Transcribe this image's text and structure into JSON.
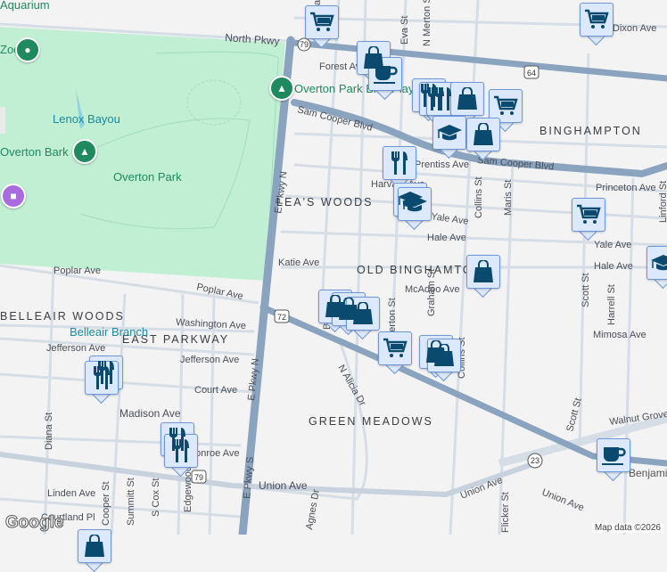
{
  "map": {
    "streets": [
      "North Pkwy",
      "Forest Ave",
      "Sam Cooper Blvd",
      "Sam Cooper Blvd",
      "E Pkwy N",
      "E Pkwy N",
      "E Pkwy S",
      "Katie Ave",
      "Poplar Ave",
      "Poplar Ave",
      "Washington Ave",
      "Jefferson Ave",
      "Jefferson Ave",
      "Court Ave",
      "Madison Ave",
      "Monroe Ave",
      "Union Ave",
      "Union Ave",
      "Union Ave",
      "Linden Ave",
      "Courtland Pl",
      "Diana St",
      "Cooper St",
      "Summitt St",
      "S Cox St",
      "Edgewood St",
      "Agnes Dr",
      "N Alicia Dr",
      "Eva St",
      "N Merton St",
      "Collins St",
      "Collins St",
      "Maris St",
      "Scott St",
      "Scott St",
      "Flicker St",
      "Princeton Ave",
      "Yale Ave",
      "Yale Ave",
      "Hale Ave",
      "Hale Ave",
      "McAdoo Ave",
      "Mimosa Ave",
      "Harrell St",
      "Linford St",
      "Walnut Grove Rd",
      "Prentiss Ave",
      "Harvard Ave",
      "Dixon Ave",
      "Merton St",
      "Graham St",
      "Baxter St",
      "Mc Lean Blvd"
    ],
    "neighborhoods": [
      "LEA'S WOODS",
      "BINGHAMPTON",
      "OLD BINGHAMTON",
      "EAST PARKWAY",
      "BELLEAIR WOODS",
      "GREEN MEADOWS"
    ],
    "places": [
      "Overton Park",
      "Lenox Bayou",
      "Overton Bark",
      "Overton Park Blvd Playground",
      "Belleair Branch",
      "Zoo",
      "Aquarium",
      "Benjamin Central"
    ],
    "route_shields": [
      "79",
      "64",
      "72",
      "79",
      "23"
    ]
  },
  "markers": [
    {
      "icon": "shopping-cart"
    },
    {
      "icon": "shopping-bag"
    },
    {
      "icon": "coffee-cup"
    },
    {
      "icon": "utensils"
    },
    {
      "icon": "utensils"
    },
    {
      "icon": "utensils"
    },
    {
      "icon": "shopping-bag"
    },
    {
      "icon": "shopping-cart"
    },
    {
      "icon": "graduation-cap"
    },
    {
      "icon": "shopping-bag"
    },
    {
      "icon": "utensils"
    },
    {
      "icon": "graduation-cap"
    },
    {
      "icon": "graduation-cap"
    },
    {
      "icon": "shopping-cart"
    },
    {
      "icon": "shopping-cart"
    },
    {
      "icon": "shopping-bag"
    },
    {
      "icon": "graduation-cap"
    },
    {
      "icon": "shopping-bag"
    },
    {
      "icon": "shopping-bag"
    },
    {
      "icon": "shopping-bag"
    },
    {
      "icon": "shopping-cart"
    },
    {
      "icon": "shopping-bag"
    },
    {
      "icon": "shopping-bag"
    },
    {
      "icon": "utensils"
    },
    {
      "icon": "utensils"
    },
    {
      "icon": "utensils"
    },
    {
      "icon": "utensils"
    },
    {
      "icon": "coffee-cup"
    },
    {
      "icon": "shopping-bag"
    }
  ],
  "colors": {
    "park": "#c1efd3",
    "highway": "#8aa3bf",
    "road": "#d5dde6",
    "marker_bg": "#dce8fb",
    "marker_icon": "#0b4a6f",
    "pin_green": "#1e8a5e",
    "pin_purple": "#a96ce0"
  },
  "footer": {
    "logo": "Google",
    "copyright": "Map data ©2026"
  }
}
